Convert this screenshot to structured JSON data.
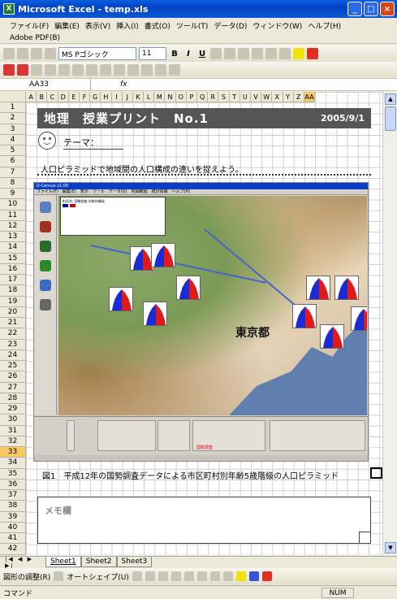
{
  "window": {
    "title": "Microsoft Excel - temp.xls",
    "min": "_",
    "max": "□",
    "close": "×"
  },
  "menu": [
    "ファイル(F)",
    "編集(E)",
    "表示(V)",
    "挿入(I)",
    "書式(O)",
    "ツール(T)",
    "データ(D)",
    "ウィンドウ(W)",
    "ヘルプ(H)"
  ],
  "adobe": "Adobe PDF(B)",
  "toolbar": {
    "font": "MS Pゴシック",
    "size": "11",
    "bold": "B",
    "italic": "I",
    "underline": "U"
  },
  "namebox": "AA33",
  "fx": "fx",
  "columns": [
    "A",
    "B",
    "C",
    "D",
    "E",
    "F",
    "G",
    "H",
    "I",
    "J",
    "K",
    "L",
    "M",
    "N",
    "O",
    "P",
    "Q",
    "R",
    "S",
    "T",
    "U",
    "V",
    "W",
    "X",
    "Y",
    "Z",
    "AA"
  ],
  "rows": [
    "1",
    "2",
    "3",
    "4",
    "5",
    "6",
    "7",
    "8",
    "9",
    "10",
    "11",
    "12",
    "13",
    "14",
    "15",
    "16",
    "17",
    "18",
    "19",
    "20",
    "21",
    "22",
    "23",
    "24",
    "25",
    "26",
    "27",
    "28",
    "29",
    "30",
    "31",
    "32",
    "33",
    "34",
    "35",
    "36",
    "37",
    "38",
    "39",
    "40",
    "41",
    "42"
  ],
  "sheet": {
    "header_title": "地理　授業プリント　No.1",
    "header_date": "2005/9/1",
    "theme_label": "テーマ：",
    "intro": "人口ピラミッドで地域間の人口構成の違いを捉えよう。",
    "map_label": "東京都",
    "app_title": "U-Census v1.00",
    "app_menu": "ファイル(F)　編集(E)　表示　ツール　データ(D)　地図範囲　統計情報　ヘルプ(H)",
    "legend_title": "町田市: 国勢調査 年齢別構成",
    "panel_note": "国勢調査",
    "caption_num": "図1",
    "caption": "平成12年の国勢調査データによる市区町村別年齢5歳階級の人口ピラミッド",
    "memo": "メモ欄"
  },
  "tabs": [
    "Sheet1",
    "Sheet2",
    "Sheet3"
  ],
  "tab_nav": "|◀ ◀ ▶ ▶|",
  "drawbar": {
    "draw": "図形の調整(R)",
    "autoshape": "オートシェイプ(U)"
  },
  "status": {
    "mode": "コマンド",
    "num": "NUM"
  },
  "colors": {
    "header_band": "#555555",
    "selection": "#f9c862",
    "title_bar": "#0a5fe0"
  }
}
